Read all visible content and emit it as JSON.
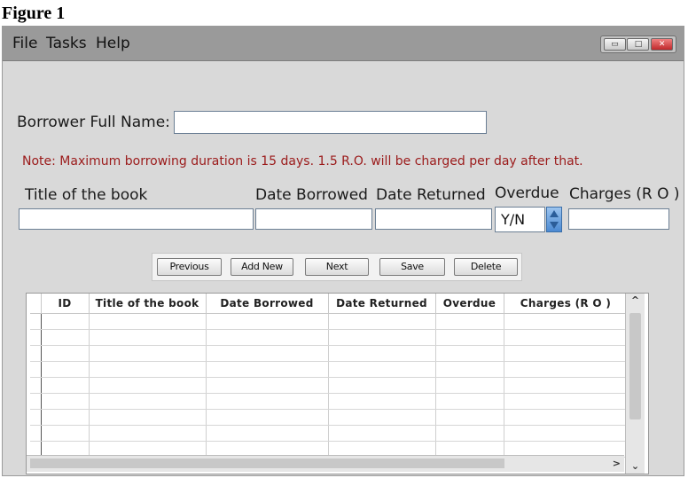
{
  "figure_label": "Figure 1",
  "menu": [
    "File",
    "Tasks",
    "Help"
  ],
  "window_controls": {
    "minimize": "▭",
    "maximize": "□",
    "close": "✕"
  },
  "form": {
    "borrower_label": "Borrower Full Name:",
    "borrower_value": "",
    "note": "Note: Maximum borrowing duration is 15 days. 1.5 R.O. will be charged per day after that.",
    "title_label": "Title of the book",
    "date_borrowed_label": "Date Borrowed",
    "date_returned_label": "Date Returned",
    "overdue_label": "Overdue",
    "overdue_value": "Y/N",
    "charges_label": "Charges (R O )"
  },
  "buttons": {
    "previous": "Previous",
    "add_new": "Add New",
    "next": "Next",
    "save": "Save",
    "delete": "Delete"
  },
  "table": {
    "columns": [
      "ID",
      "Title of the book",
      "Date Borrowed",
      "Date Returned",
      "Overdue",
      "Charges (R O )"
    ],
    "visible_empty_rows": 9
  },
  "scroll_glyphs": {
    "up": "^",
    "down": "⌄",
    "right": ">"
  },
  "colors": {
    "menubar": "#9a9a9a",
    "window_bg": "#d9d9d9",
    "note_text": "#9b1a1a",
    "spinner": "#4a89d2"
  }
}
